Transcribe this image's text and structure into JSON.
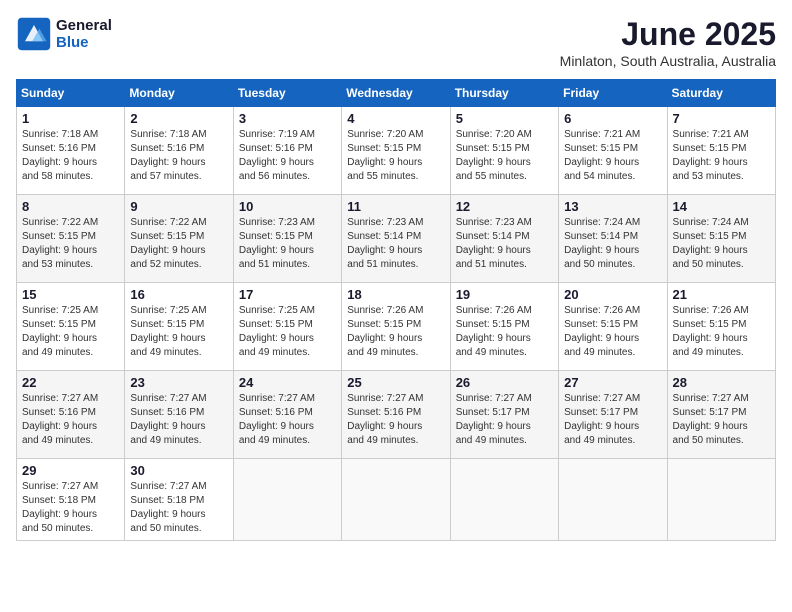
{
  "header": {
    "logo_line1": "General",
    "logo_line2": "Blue",
    "month": "June 2025",
    "location": "Minlaton, South Australia, Australia"
  },
  "weekdays": [
    "Sunday",
    "Monday",
    "Tuesday",
    "Wednesday",
    "Thursday",
    "Friday",
    "Saturday"
  ],
  "weeks": [
    [
      {
        "day": 1,
        "info": "Sunrise: 7:18 AM\nSunset: 5:16 PM\nDaylight: 9 hours\nand 58 minutes."
      },
      {
        "day": 2,
        "info": "Sunrise: 7:18 AM\nSunset: 5:16 PM\nDaylight: 9 hours\nand 57 minutes."
      },
      {
        "day": 3,
        "info": "Sunrise: 7:19 AM\nSunset: 5:16 PM\nDaylight: 9 hours\nand 56 minutes."
      },
      {
        "day": 4,
        "info": "Sunrise: 7:20 AM\nSunset: 5:15 PM\nDaylight: 9 hours\nand 55 minutes."
      },
      {
        "day": 5,
        "info": "Sunrise: 7:20 AM\nSunset: 5:15 PM\nDaylight: 9 hours\nand 55 minutes."
      },
      {
        "day": 6,
        "info": "Sunrise: 7:21 AM\nSunset: 5:15 PM\nDaylight: 9 hours\nand 54 minutes."
      },
      {
        "day": 7,
        "info": "Sunrise: 7:21 AM\nSunset: 5:15 PM\nDaylight: 9 hours\nand 53 minutes."
      }
    ],
    [
      {
        "day": 8,
        "info": "Sunrise: 7:22 AM\nSunset: 5:15 PM\nDaylight: 9 hours\nand 53 minutes."
      },
      {
        "day": 9,
        "info": "Sunrise: 7:22 AM\nSunset: 5:15 PM\nDaylight: 9 hours\nand 52 minutes."
      },
      {
        "day": 10,
        "info": "Sunrise: 7:23 AM\nSunset: 5:15 PM\nDaylight: 9 hours\nand 51 minutes."
      },
      {
        "day": 11,
        "info": "Sunrise: 7:23 AM\nSunset: 5:14 PM\nDaylight: 9 hours\nand 51 minutes."
      },
      {
        "day": 12,
        "info": "Sunrise: 7:23 AM\nSunset: 5:14 PM\nDaylight: 9 hours\nand 51 minutes."
      },
      {
        "day": 13,
        "info": "Sunrise: 7:24 AM\nSunset: 5:14 PM\nDaylight: 9 hours\nand 50 minutes."
      },
      {
        "day": 14,
        "info": "Sunrise: 7:24 AM\nSunset: 5:15 PM\nDaylight: 9 hours\nand 50 minutes."
      }
    ],
    [
      {
        "day": 15,
        "info": "Sunrise: 7:25 AM\nSunset: 5:15 PM\nDaylight: 9 hours\nand 49 minutes."
      },
      {
        "day": 16,
        "info": "Sunrise: 7:25 AM\nSunset: 5:15 PM\nDaylight: 9 hours\nand 49 minutes."
      },
      {
        "day": 17,
        "info": "Sunrise: 7:25 AM\nSunset: 5:15 PM\nDaylight: 9 hours\nand 49 minutes."
      },
      {
        "day": 18,
        "info": "Sunrise: 7:26 AM\nSunset: 5:15 PM\nDaylight: 9 hours\nand 49 minutes."
      },
      {
        "day": 19,
        "info": "Sunrise: 7:26 AM\nSunset: 5:15 PM\nDaylight: 9 hours\nand 49 minutes."
      },
      {
        "day": 20,
        "info": "Sunrise: 7:26 AM\nSunset: 5:15 PM\nDaylight: 9 hours\nand 49 minutes."
      },
      {
        "day": 21,
        "info": "Sunrise: 7:26 AM\nSunset: 5:15 PM\nDaylight: 9 hours\nand 49 minutes."
      }
    ],
    [
      {
        "day": 22,
        "info": "Sunrise: 7:27 AM\nSunset: 5:16 PM\nDaylight: 9 hours\nand 49 minutes."
      },
      {
        "day": 23,
        "info": "Sunrise: 7:27 AM\nSunset: 5:16 PM\nDaylight: 9 hours\nand 49 minutes."
      },
      {
        "day": 24,
        "info": "Sunrise: 7:27 AM\nSunset: 5:16 PM\nDaylight: 9 hours\nand 49 minutes."
      },
      {
        "day": 25,
        "info": "Sunrise: 7:27 AM\nSunset: 5:16 PM\nDaylight: 9 hours\nand 49 minutes."
      },
      {
        "day": 26,
        "info": "Sunrise: 7:27 AM\nSunset: 5:17 PM\nDaylight: 9 hours\nand 49 minutes."
      },
      {
        "day": 27,
        "info": "Sunrise: 7:27 AM\nSunset: 5:17 PM\nDaylight: 9 hours\nand 49 minutes."
      },
      {
        "day": 28,
        "info": "Sunrise: 7:27 AM\nSunset: 5:17 PM\nDaylight: 9 hours\nand 50 minutes."
      }
    ],
    [
      {
        "day": 29,
        "info": "Sunrise: 7:27 AM\nSunset: 5:18 PM\nDaylight: 9 hours\nand 50 minutes."
      },
      {
        "day": 30,
        "info": "Sunrise: 7:27 AM\nSunset: 5:18 PM\nDaylight: 9 hours\nand 50 minutes."
      },
      null,
      null,
      null,
      null,
      null
    ]
  ]
}
